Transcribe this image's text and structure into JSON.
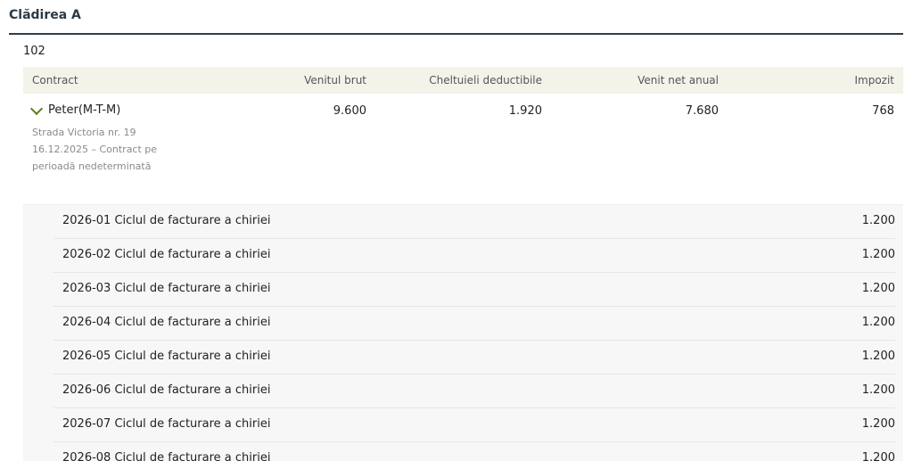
{
  "building": {
    "title": "Clădirea A"
  },
  "unit": {
    "label": "102"
  },
  "table": {
    "headers": {
      "contract": "Contract",
      "gross": "Venitul brut",
      "deductible": "Cheltuieli deductibile",
      "net": "Venit net anual",
      "tax": "Impozit"
    },
    "contract": {
      "name": "Peter(M-T-M)",
      "address": "Strada Victoria nr. 19",
      "detail": "16.12.2025 – Contract pe perioadă nedeterminată",
      "gross": "9.600",
      "deductible": "1.920",
      "net": "7.680",
      "tax": "768",
      "accent_color": "#5a7d1f"
    },
    "cycles": [
      {
        "label": "2026-01 Ciclul de facturare a chiriei",
        "amount": "1.200"
      },
      {
        "label": "2026-02 Ciclul de facturare a chiriei",
        "amount": "1.200"
      },
      {
        "label": "2026-03 Ciclul de facturare a chiriei",
        "amount": "1.200"
      },
      {
        "label": "2026-04 Ciclul de facturare a chiriei",
        "amount": "1.200"
      },
      {
        "label": "2026-05 Ciclul de facturare a chiriei",
        "amount": "1.200"
      },
      {
        "label": "2026-06 Ciclul de facturare a chiriei",
        "amount": "1.200"
      },
      {
        "label": "2026-07 Ciclul de facturare a chiriei",
        "amount": "1.200"
      },
      {
        "label": "2026-08 Ciclul de facturare a chiriei",
        "amount": "1.200"
      }
    ]
  }
}
